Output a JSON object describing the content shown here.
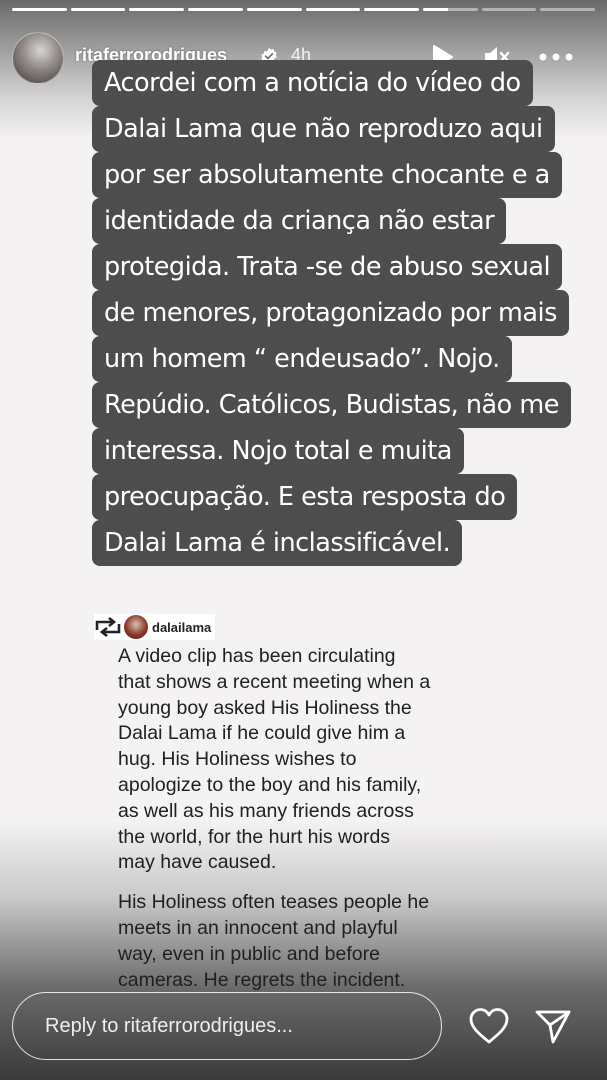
{
  "progress": [
    1,
    1,
    1,
    1,
    1,
    1,
    1,
    0.45,
    0,
    0
  ],
  "header": {
    "username": "ritaferrorodrigues",
    "time": "4h"
  },
  "story_lines": [
    "Acordei com a notícia do vídeo do",
    "Dalai Lama que não reproduzo aqui",
    "por ser absolutamente chocante e a",
    "identidade da criança não estar",
    "protegida. Trata -se de abuso sexual",
    "de menores, protagonizado por mais",
    "um homem “ endeusado”. Nojo.",
    "Repúdio. Católicos, Budistas, não me",
    "interessa. Nojo total e muita",
    "preocupação.  E esta resposta do",
    "Dalai Lama é inclassificável."
  ],
  "repost": {
    "username": "dalailama",
    "paragraph1_lines": [
      "A video clip has been circulating",
      "that shows a recent meeting when a",
      "young boy asked His Holiness the",
      "Dalai Lama if he could give him a",
      "hug. His Holiness wishes to",
      "apologize to the boy and his family,",
      "as well as his many friends across",
      "the world, for the hurt his words",
      "may have caused."
    ],
    "paragraph2_lines": [
      "His Holiness often teases people he",
      "meets in an innocent and playful",
      "way, even in public and before",
      "cameras. He regrets the incident."
    ]
  },
  "footer": {
    "reply_placeholder": "Reply to ritaferrorodrigues..."
  },
  "icons": {
    "play": "play-icon",
    "mute": "mute-icon",
    "more": "more-icon",
    "verified": "verified-badge-icon",
    "repost": "repost-icon",
    "like": "heart-icon",
    "send": "send-icon"
  },
  "colors": {
    "text_bg": "#4d4d4d",
    "page_bg": "#f4f2f2"
  }
}
